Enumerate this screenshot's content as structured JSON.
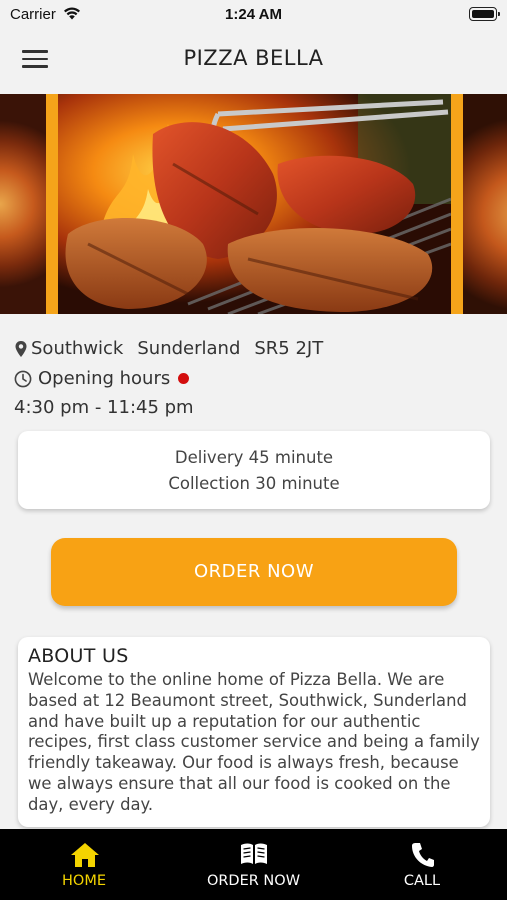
{
  "status_bar": {
    "carrier": "Carrier",
    "time": "1:24 AM"
  },
  "header": {
    "title": "PIZZA BELLA"
  },
  "banner": {
    "image": "grilled-meat-on-flames-photo"
  },
  "location": {
    "area": "Southwick",
    "city": "Sunderland",
    "postcode": "SR5 2JT"
  },
  "hours": {
    "label": "Opening hours",
    "range": "4:30 pm - 11:45 pm",
    "status_color": "#d30d0d"
  },
  "delivery": {
    "delivery_text": "Delivery 45 minute",
    "collection_text": "Collection 30 minute"
  },
  "order_button": {
    "label": "ORDER NOW"
  },
  "about": {
    "heading": "ABOUT US",
    "text": "Welcome to the online home of Pizza Bella. We are based at 12 Beaumont street, Southwick, Sunderland and have built up a reputation for our authentic recipes, first class customer service and being a family friendly takeaway. Our food is always fresh, because we always ensure that all our food is cooked on the day, every day."
  },
  "tabbar": {
    "home": "HOME",
    "order": "ORDER NOW",
    "call": "CALL"
  },
  "colors": {
    "accent": "#f8a214",
    "tab_active": "#f4d400",
    "tab_bg": "#000000"
  }
}
